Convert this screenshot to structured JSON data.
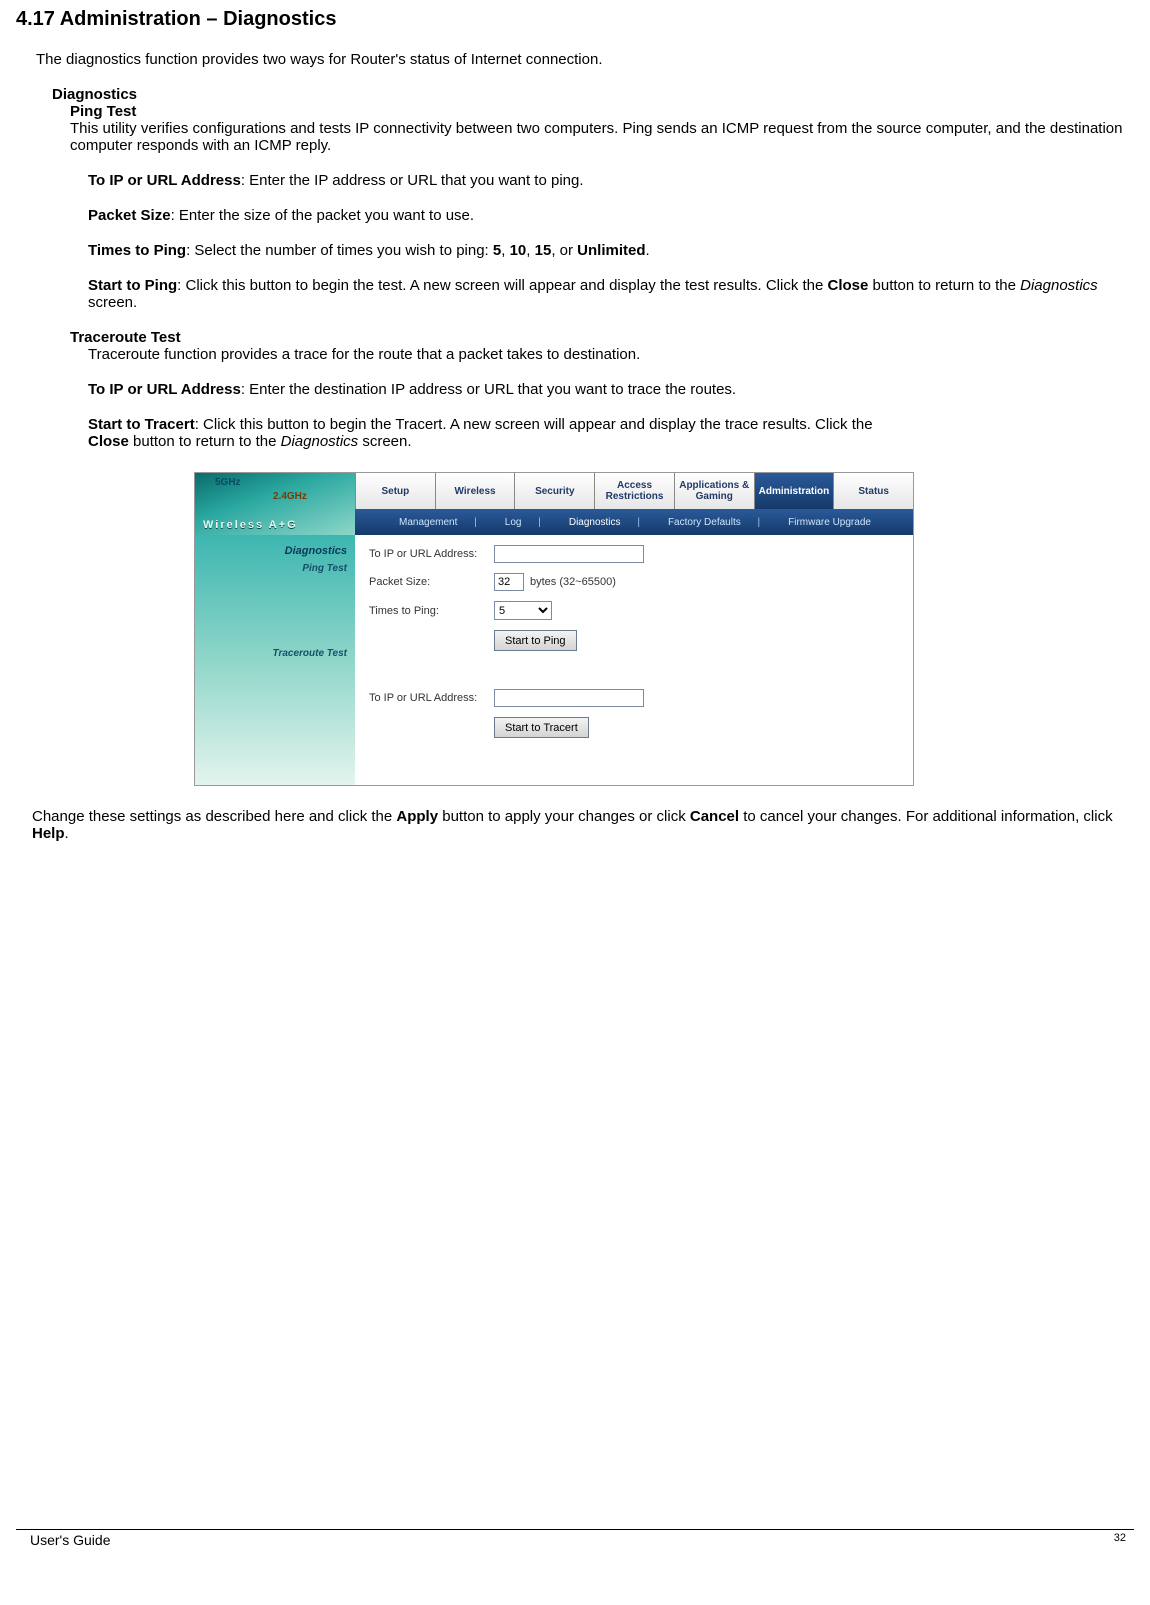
{
  "doc": {
    "section_title": "4.17 Administration – Diagnostics",
    "intro": "The diagnostics function provides two ways for Router's status of Internet connection.",
    "diagnostics_heading": "Diagnostics",
    "ping_test_heading": "Ping Test",
    "ping_test_desc": "This utility verifies configurations and tests IP connectivity between two computers. Ping sends an ICMP request from the source computer, and the destination computer responds with an ICMP reply.",
    "ping_ip_label": "To IP or URL Address",
    "ping_ip_text": ": Enter the IP address or URL that you want to ping.",
    "packet_size_label": "Packet Size",
    "packet_size_text": ": Enter the size of the packet you want to use.",
    "times_to_ping_label": "Times to Ping",
    "times_to_ping_text_a": ": Select the number of times you wish to ping: ",
    "opt5": "5",
    "c1": ", ",
    "opt10": "10",
    "c2": ", ",
    "opt15": "15",
    "c3": ", or ",
    "optUnl": "Unlimited",
    "period": ".",
    "start_to_ping_label": "Start to Ping",
    "start_to_ping_text_a": ": Click this button to begin the test. A new screen will appear and display the test results. Click the ",
    "close_label_1": "Close",
    "start_to_ping_text_b": " button to return to the ",
    "diag_italic_1": "Diagnostics",
    "start_to_ping_text_c": " screen.",
    "traceroute_heading": "Traceroute Test",
    "traceroute_desc": "Traceroute function provides a trace for the route that a packet takes to destination.",
    "trace_ip_label": "To IP or URL Address",
    "trace_ip_text": ": Enter the destination IP address or URL that you want to trace the routes.",
    "start_tracert_label": "Start to Tracert",
    "start_tracert_text_a": ": Click this button to begin the Tracert. A new screen will appear and display the trace results. Click the",
    "close_label_2": "Close",
    "start_tracert_text_b": " button to return to the ",
    "diag_italic_2": "Diagnostics",
    "start_tracert_text_c": " screen.",
    "closing_a": "Change these settings as described here and click the ",
    "apply": "Apply",
    "closing_b": " button to apply your changes or click ",
    "cancel": "Cancel",
    "closing_c": " to cancel your changes. For additional information, click ",
    "help": "Help",
    "closing_d": "."
  },
  "router": {
    "logo_band": "5GHz",
    "logo_band2": "2.4GHz",
    "logo_text": "Wireless A+G",
    "tabs": [
      "Setup",
      "Wireless",
      "Security",
      "Access Restrictions",
      "Applications & Gaming",
      "Administration",
      "Status"
    ],
    "active_tab_index": 5,
    "subtabs": [
      "Management",
      "Log",
      "Diagnostics",
      "Factory Defaults",
      "Firmware Upgrade"
    ],
    "active_subtab_index": 2,
    "sidebar": {
      "heading": "Diagnostics",
      "ping": "Ping Test",
      "trace": "Traceroute Test"
    },
    "form": {
      "ip_label": "To IP or URL Address:",
      "packet_label": "Packet Size:",
      "packet_value": "32",
      "packet_note": "bytes (32~65500)",
      "times_label": "Times to Ping:",
      "times_value": "5",
      "start_ping_btn": "Start to Ping",
      "trace_ip_label": "To IP or URL Address:",
      "start_tracert_btn": "Start to Tracert"
    }
  },
  "footer": {
    "guide": "User's Guide",
    "page": "32"
  }
}
